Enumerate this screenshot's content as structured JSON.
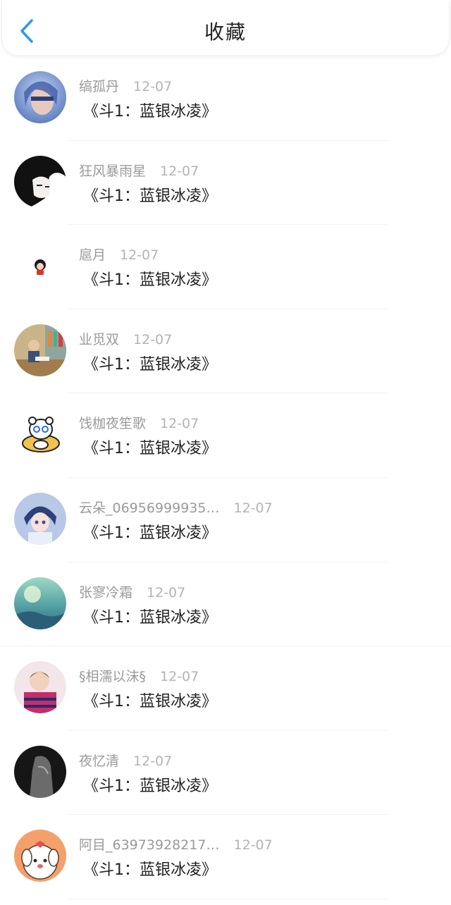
{
  "header": {
    "title": "收藏"
  },
  "colors": {
    "accent": "#2e9be6"
  },
  "items": [
    {
      "name": "缟孤丹",
      "date": "12-07",
      "book": "《斗1：蓝银冰凌》",
      "avatar": "avatar-blue-girl"
    },
    {
      "name": "狂风暴雨星",
      "date": "12-07",
      "book": "《斗1：蓝银冰凌》",
      "avatar": "avatar-anime-bw"
    },
    {
      "name": "扈月",
      "date": "12-07",
      "book": "《斗1：蓝银冰凌》",
      "avatar": "avatar-small-figure"
    },
    {
      "name": "业觅双",
      "date": "12-07",
      "book": "《斗1：蓝银冰凌》",
      "avatar": "avatar-child-reading"
    },
    {
      "name": "饯枷夜笙歌",
      "date": "12-07",
      "book": "《斗1：蓝银冰凌》",
      "avatar": "avatar-bear-sticker"
    },
    {
      "name": "云朵_06956999935…",
      "date": "12-07",
      "book": "《斗1：蓝银冰凌》",
      "avatar": "avatar-anime-boy"
    },
    {
      "name": "张寥冷霜",
      "date": "12-07",
      "book": "《斗1：蓝银冰凌》",
      "avatar": "avatar-teal-landscape"
    },
    {
      "name": "§相濡以沫§",
      "date": "12-07",
      "book": "《斗1：蓝银冰凌》",
      "avatar": "avatar-child-photo"
    },
    {
      "name": "夜忆清",
      "date": "12-07",
      "book": "《斗1：蓝银冰凌》",
      "avatar": "avatar-dark-figure"
    },
    {
      "name": "阿目_63973928217…",
      "date": "12-07",
      "book": "《斗1：蓝银冰凌》",
      "avatar": "avatar-cute-dog"
    }
  ]
}
